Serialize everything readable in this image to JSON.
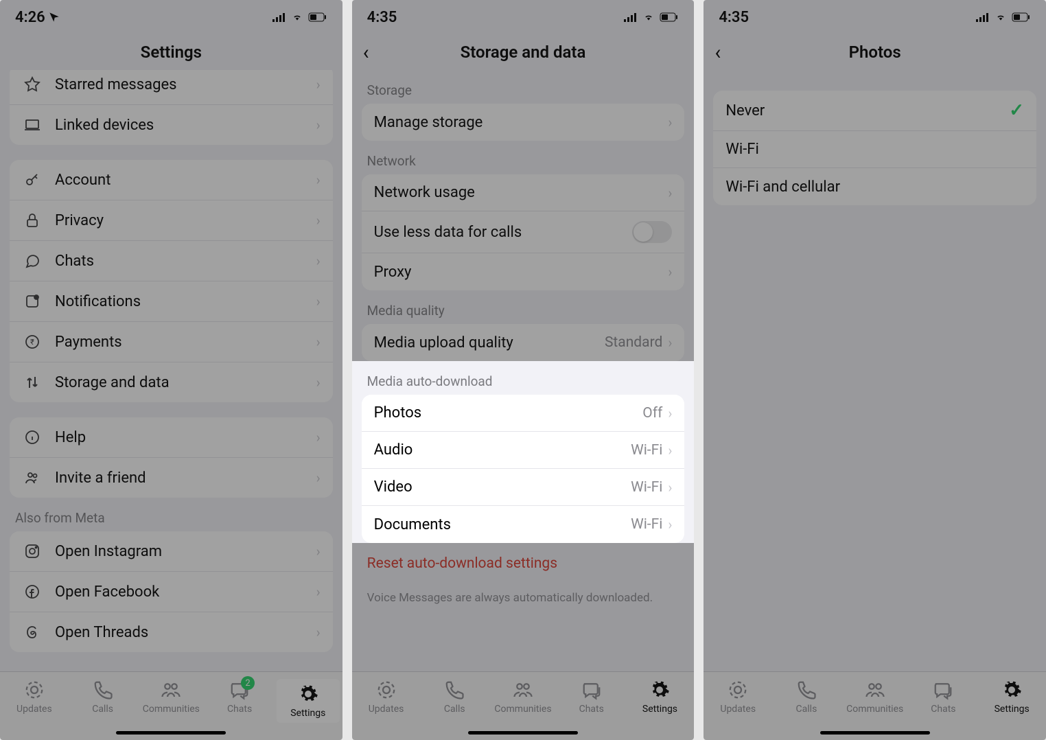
{
  "screen1": {
    "time": "4:26",
    "title": "Settings",
    "rows": {
      "starred": "Starred messages",
      "linked": "Linked devices",
      "account": "Account",
      "privacy": "Privacy",
      "chats": "Chats",
      "notifications": "Notifications",
      "payments": "Payments",
      "storage": "Storage and data",
      "help": "Help",
      "invite": "Invite a friend"
    },
    "meta_header": "Also from Meta",
    "meta": {
      "instagram": "Open Instagram",
      "facebook": "Open Facebook",
      "threads": "Open Threads"
    },
    "chats_badge": "2"
  },
  "screen2": {
    "time": "4:35",
    "title": "Storage and data",
    "sections": {
      "storage": "Storage",
      "network": "Network",
      "quality": "Media quality",
      "autodl": "Media auto-download"
    },
    "rows": {
      "manage": "Manage storage",
      "usage": "Network usage",
      "lessdata": "Use less data for calls",
      "proxy": "Proxy",
      "upload_quality": "Media upload quality",
      "upload_quality_value": "Standard",
      "photos": "Photos",
      "photos_value": "Off",
      "audio": "Audio",
      "audio_value": "Wi-Fi",
      "video": "Video",
      "video_value": "Wi-Fi",
      "documents": "Documents",
      "documents_value": "Wi-Fi"
    },
    "reset": "Reset auto-download settings",
    "footer": "Voice Messages are always automatically downloaded."
  },
  "screen3": {
    "time": "4:35",
    "title": "Photos",
    "options": {
      "never": "Never",
      "wifi": "Wi-Fi",
      "cellular": "Wi-Fi and cellular"
    }
  },
  "tabs": {
    "updates": "Updates",
    "calls": "Calls",
    "communities": "Communities",
    "chats": "Chats",
    "settings": "Settings"
  }
}
